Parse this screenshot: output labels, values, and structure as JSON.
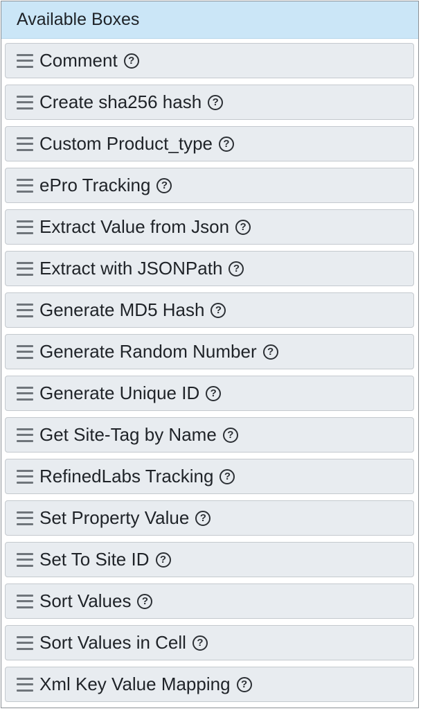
{
  "header": {
    "title": "Available Boxes"
  },
  "icons": {
    "drag": "drag-handle-icon",
    "help": "help-circle-icon",
    "help_glyph": "?"
  },
  "boxes": [
    {
      "label": "Comment"
    },
    {
      "label": "Create sha256 hash"
    },
    {
      "label": "Custom Product_type"
    },
    {
      "label": "ePro Tracking"
    },
    {
      "label": "Extract Value from Json"
    },
    {
      "label": "Extract with JSONPath"
    },
    {
      "label": "Generate MD5 Hash"
    },
    {
      "label": "Generate Random Number"
    },
    {
      "label": "Generate Unique ID"
    },
    {
      "label": "Get Site-Tag by Name"
    },
    {
      "label": "RefinedLabs Tracking"
    },
    {
      "label": "Set Property Value"
    },
    {
      "label": "Set To Site ID"
    },
    {
      "label": "Sort Values"
    },
    {
      "label": "Sort Values in Cell"
    },
    {
      "label": "Xml Key Value Mapping"
    }
  ]
}
